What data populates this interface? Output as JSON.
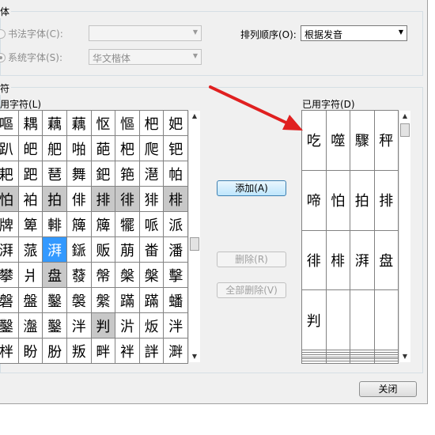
{
  "font_group": {
    "title": "体",
    "calligraphy_label": "书法字体(C):",
    "calligraphy_value": "",
    "system_label": "系统字体(S):",
    "system_value": "华文楷体"
  },
  "sort": {
    "label": "排列顺序(O):",
    "value": "根据发音"
  },
  "char_group": {
    "title": "符"
  },
  "available": {
    "label": "可用字符(L)",
    "rows": [
      [
        "嘔",
        "耦",
        "藕",
        "藕",
        "怄",
        "慪",
        "杷",
        "妑"
      ],
      [
        "趴",
        "皅",
        "舥",
        "啪",
        "葩",
        "杷",
        "爬",
        "钯"
      ],
      [
        "耙",
        "跁",
        "琶",
        "舞",
        "鈀",
        "筢",
        "潖",
        "帕"
      ],
      [
        "怕",
        "袙",
        "拍",
        "俳",
        "排",
        "徘",
        "猅",
        "棑"
      ],
      [
        "牌",
        "箄",
        "輫",
        "簰",
        "簰",
        "犤",
        "哌",
        "派"
      ],
      [
        "湃",
        "蒎",
        "湃",
        "鎃",
        "贩",
        "萠",
        "畨",
        "潘"
      ],
      [
        "攀",
        "爿",
        "盘",
        "蕟",
        "幋",
        "槃",
        "槃",
        "擊"
      ],
      [
        "磐",
        "盤",
        "鑿",
        "褩",
        "縏",
        "蹣",
        "蹣",
        "蟠"
      ],
      [
        "鑿",
        "瀊",
        "鑿",
        "泮",
        "判",
        "沜",
        "炍",
        "泮"
      ],
      [
        "柈",
        "盼",
        "肦",
        "叛",
        "畔",
        "袢",
        "詊",
        "溿"
      ]
    ],
    "gray_cells": [
      "3-0",
      "3-2",
      "3-4",
      "3-5",
      "3-7",
      "6-2",
      "8-4"
    ],
    "selected_cells": [
      "5-2"
    ]
  },
  "used": {
    "label": "已用字符(D)",
    "chars": [
      "吃",
      "噬",
      "驟",
      "秤",
      "啼",
      "怕",
      "拍",
      "排",
      "徘",
      "棑",
      "湃",
      "盘",
      "判"
    ]
  },
  "buttons": {
    "add": "添加(A)",
    "remove": "删除(R)",
    "remove_all": "全部删除(V)",
    "close": "关闭"
  },
  "colors": {
    "arrow": "#e02020",
    "selected": "#3399ff",
    "used_cell": "#c8c8c8"
  },
  "icons": {
    "scroll_up": "▲",
    "scroll_down": "▼",
    "dropdown": "▼"
  }
}
